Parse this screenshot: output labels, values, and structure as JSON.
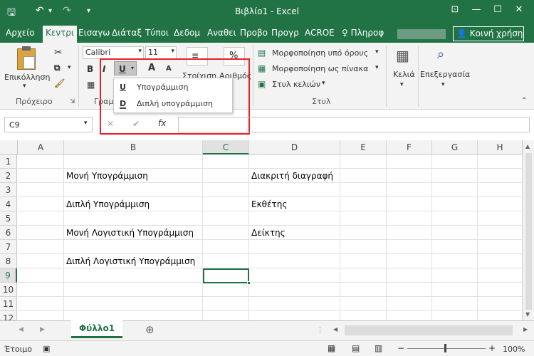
{
  "titlebar": {
    "title": "Βιβλίο1 - Excel",
    "save_icon": "save-icon",
    "undo_icon": "undo-icon",
    "redo_icon": "redo-icon"
  },
  "window": {
    "minimize": "—",
    "maximize": "☐",
    "close": "✕",
    "ribbon_display": "⊡"
  },
  "tabs": [
    {
      "label": "Αρχείο"
    },
    {
      "label": "Κεντρι"
    },
    {
      "label": "Εισαγω"
    },
    {
      "label": "Διάταξ"
    },
    {
      "label": "Τύποι"
    },
    {
      "label": "Δεδομ"
    },
    {
      "label": "Αναθει"
    },
    {
      "label": "Προβο"
    },
    {
      "label": "Προγρ"
    },
    {
      "label": "ACROE"
    },
    {
      "label": "Πληροφ"
    }
  ],
  "active_tab": "Κεντρι",
  "share_label": "Κοινή χρήση",
  "ribbon": {
    "paste_label": "Επικόλληση",
    "clipboard_group": "Πρόχειρο",
    "font_name": "Calibri",
    "font_size": "11",
    "bold": "B",
    "italic": "I",
    "underline": "U",
    "grow_font": "A",
    "shrink_font": "A",
    "font_group_partial": "Γραμ",
    "alignment_partial": "Στοίχιση",
    "number_partial": "Αριθμός",
    "percent": "%",
    "conditional_format": "Μορφοποίηση υπό όρους",
    "format_as_table": "Μορφοποίηση ως πίνακα",
    "cell_styles": "Στυλ κελιών",
    "styles_group": "Στυλ",
    "cells_label": "Κελιά",
    "editing_label": "Επεξεργασία"
  },
  "underline_menu": {
    "items": [
      {
        "icon": "U",
        "label": "Υπογράμμιση"
      },
      {
        "icon": "D",
        "label": "Διπλή υπογράμμιση"
      }
    ]
  },
  "formula_bar": {
    "name_box": "C9",
    "fx": "fx",
    "cancel": "✕",
    "enter": "✔",
    "value": ""
  },
  "columns": [
    "A",
    "B",
    "C",
    "D",
    "E",
    "F",
    "G",
    "H"
  ],
  "rows": [
    "1",
    "2",
    "3",
    "4",
    "5",
    "6",
    "7",
    "8",
    "9",
    "10",
    "11",
    "12"
  ],
  "cells": {
    "B2": "Μονή Υπογράμμιση",
    "B4": "Διπλή Υπογράμμιση",
    "B6": "Μονή Λογιστική Υπογράμμιση",
    "B8": "Διπλή Λογιστική Υπογράμμιση",
    "D2": "Διακριτή διαγραφή",
    "D4": "Εκθέτης",
    "D6": "Δείκτης"
  },
  "active_cell": "C9",
  "sheet_tab": "Φύλλο1",
  "add_sheet": "⊕",
  "status": {
    "ready": "Έτοιμο",
    "zoom": "100%"
  },
  "colors": {
    "accent": "#217346",
    "highlight": "#e8202a"
  }
}
